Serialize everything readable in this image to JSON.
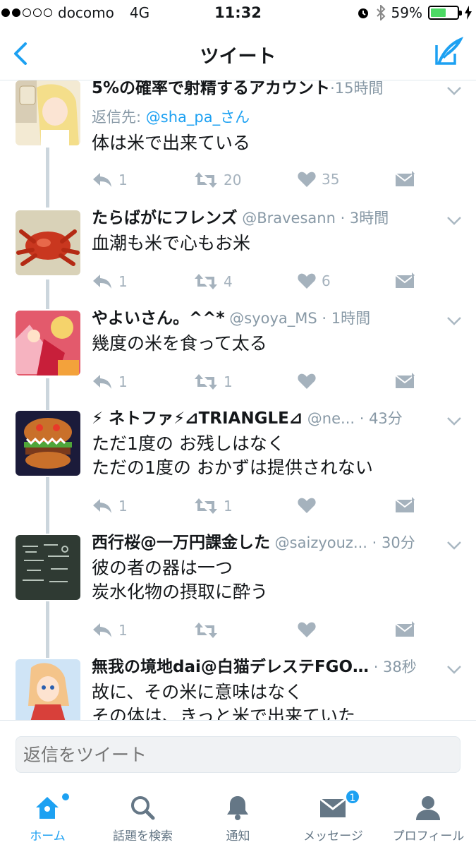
{
  "status_bar": {
    "carrier": "docomo",
    "network": "4G",
    "time": "11:32",
    "battery": "59%",
    "battery_level": 0.59
  },
  "nav": {
    "title": "ツイート"
  },
  "tweets": [
    {
      "name": "5%の確率で射精するアカウント",
      "meta": "·15時間",
      "reply_label": "返信先: ",
      "reply_handle": "@sha_pa_さん",
      "text": "体は米で出来ている",
      "replies": "1",
      "retweets": "20",
      "likes": "35"
    },
    {
      "name": "たらばがにフレンズ",
      "meta": " @Bravesann · 3時間",
      "text": "血潮も米で心もお米",
      "replies": "1",
      "retweets": "4",
      "likes": "6"
    },
    {
      "name": "やよいさん。^^*",
      "meta": " @syoya_MS · 1時間",
      "text": "幾度の米を食って太る",
      "replies": "1",
      "retweets": "1",
      "likes": ""
    },
    {
      "name": "⚡ ネトファ⚡⊿TRIANGLE⊿",
      "meta": " @ne... · 43分",
      "text": "ただ1度の お残しはなく\nただの1度の おかずは提供されない",
      "replies": "1",
      "retweets": "1",
      "likes": ""
    },
    {
      "name": "西行桜@一万円課金した",
      "meta": " @saizyouz... · 30分",
      "text": "彼の者の器は一つ\n炭水化物の摂取に酔う",
      "replies": "1",
      "retweets": "",
      "likes": ""
    },
    {
      "name": "無我の境地dai@白猫デレステFGO…",
      "meta": " · 38秒",
      "text": "故に、その米に意味はなく\nその体は、きっと米で出来ていた",
      "replies": "",
      "retweets": "",
      "likes": ""
    }
  ],
  "reply_bar": {
    "placeholder": "返信をツイート"
  },
  "tabs": [
    {
      "label": "ホーム",
      "icon": "home-icon",
      "active": true
    },
    {
      "label": "話題を検索",
      "icon": "search-icon",
      "active": false
    },
    {
      "label": "通知",
      "icon": "bell-icon",
      "active": false
    },
    {
      "label": "メッセージ",
      "icon": "envelope-icon",
      "active": false,
      "badge": "1"
    },
    {
      "label": "プロフィール",
      "icon": "person-icon",
      "active": false
    }
  ],
  "colors": {
    "accent": "#1da1f2",
    "meta": "#8899a6",
    "action": "#a5b2bd"
  }
}
